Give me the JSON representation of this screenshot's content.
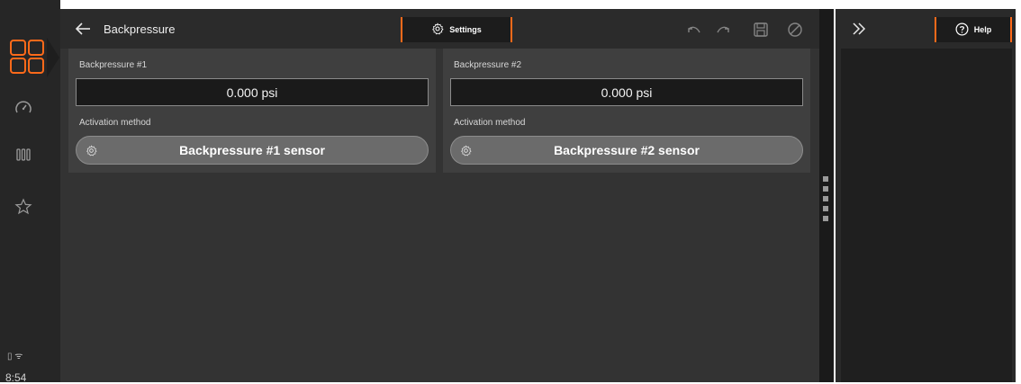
{
  "rail": {
    "items": [
      {
        "name": "apps-icon"
      },
      {
        "name": "gauge-icon"
      },
      {
        "name": "columns-icon"
      },
      {
        "name": "star-icon"
      }
    ],
    "status_icons": "▯ ᯤ",
    "time": "8:54",
    "accent": "#ff6a1a"
  },
  "header": {
    "title": "Backpressure",
    "settings_label": "Settings"
  },
  "cards": [
    {
      "label": "Backpressure #1",
      "value": "0.000 psi",
      "method_label": "Activation method",
      "method_value": "Backpressure #1 sensor"
    },
    {
      "label": "Backpressure #2",
      "value": "0.000 psi",
      "method_label": "Activation method",
      "method_value": "Backpressure #2 sensor"
    }
  ],
  "help": {
    "label": "Help"
  }
}
